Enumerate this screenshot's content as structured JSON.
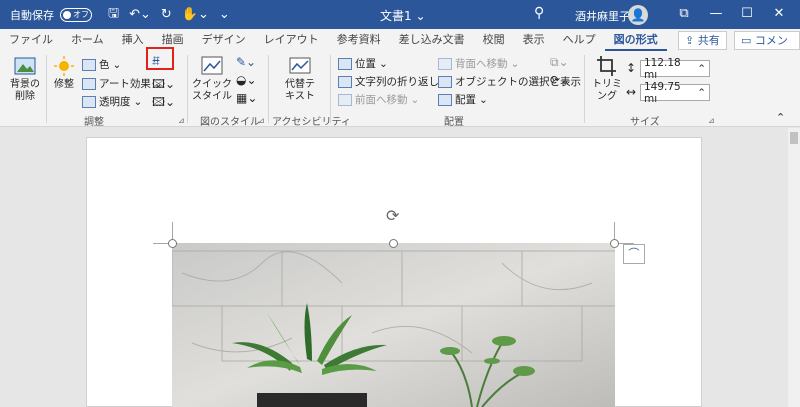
{
  "titlebar": {
    "autosave_label": "自動保存",
    "autosave_state": "オフ",
    "doc_title": "文書1 ⌄",
    "user_name": "酒井麻里子"
  },
  "tabs": [
    "ファイル",
    "ホーム",
    "挿入",
    "描画",
    "デザイン",
    "レイアウト",
    "参考資料",
    "差し込み文書",
    "校閲",
    "表示",
    "ヘルプ",
    "図の形式"
  ],
  "active_tab": "図の形式",
  "share_label": "共有",
  "comment_label": "コメント",
  "ribbon": {
    "remove_bg_label": "背景の\n削除",
    "corrections_label": "修整",
    "color_label": "色",
    "art_effects_label": "アート効果",
    "transparency_label": "透明度",
    "adjust_group": "調整",
    "quick_styles_label": "クイック\nスタイル",
    "picture_styles_group": "図のスタイル",
    "alt_text_label": "代替テ\nキスト",
    "accessibility_group": "アクセシビリティ",
    "position_label": "位置",
    "wrap_text_label": "文字列の折り返し",
    "bring_forward_label": "前面へ移動",
    "send_backward_label": "背面へ移動",
    "selection_pane_label": "オブジェクトの選択と表示",
    "align_label": "配置",
    "arrange_group": "配置",
    "crop_label": "トリミング",
    "height_value": "112.18 mı",
    "width_value": "149.75 mı",
    "size_group": "サイズ"
  },
  "colors": {
    "titlebar": "#2b579a",
    "accent": "#2b579a",
    "highlight": "#e0221b"
  }
}
